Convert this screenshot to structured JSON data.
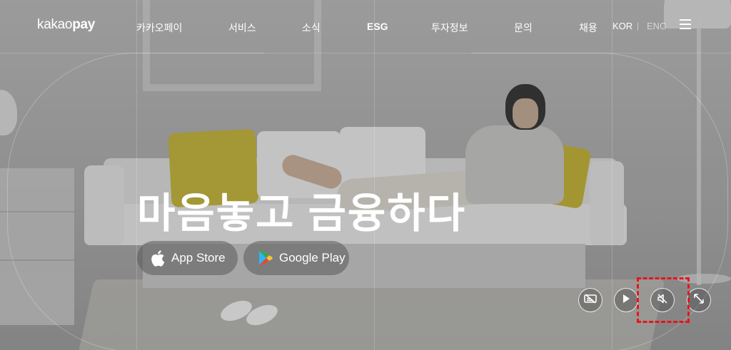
{
  "header": {
    "logo_regular": "kakao",
    "logo_bold": "pay",
    "nav": [
      {
        "label": "카카오페이"
      },
      {
        "label": "서비스"
      },
      {
        "label": "소식"
      },
      {
        "label": "ESG"
      },
      {
        "label": "투자정보"
      },
      {
        "label": "문의"
      },
      {
        "label": "채용"
      }
    ],
    "lang_current": "KOR",
    "lang_separator": "|",
    "lang_other": "ENG",
    "menu_icon": "hamburger-icon"
  },
  "hero": {
    "headline": "마음놓고 금융하다",
    "app_store_label": "App Store",
    "google_play_label": "Google Play",
    "app_store_icon": "apple-icon",
    "google_play_icon": "google-play-icon"
  },
  "controls": [
    {
      "name": "captions-off-icon"
    },
    {
      "name": "play-icon"
    },
    {
      "name": "mute-icon"
    },
    {
      "name": "fullscreen-icon"
    }
  ],
  "colors": {
    "highlight": "#e8141c",
    "text": "#ffffff"
  }
}
